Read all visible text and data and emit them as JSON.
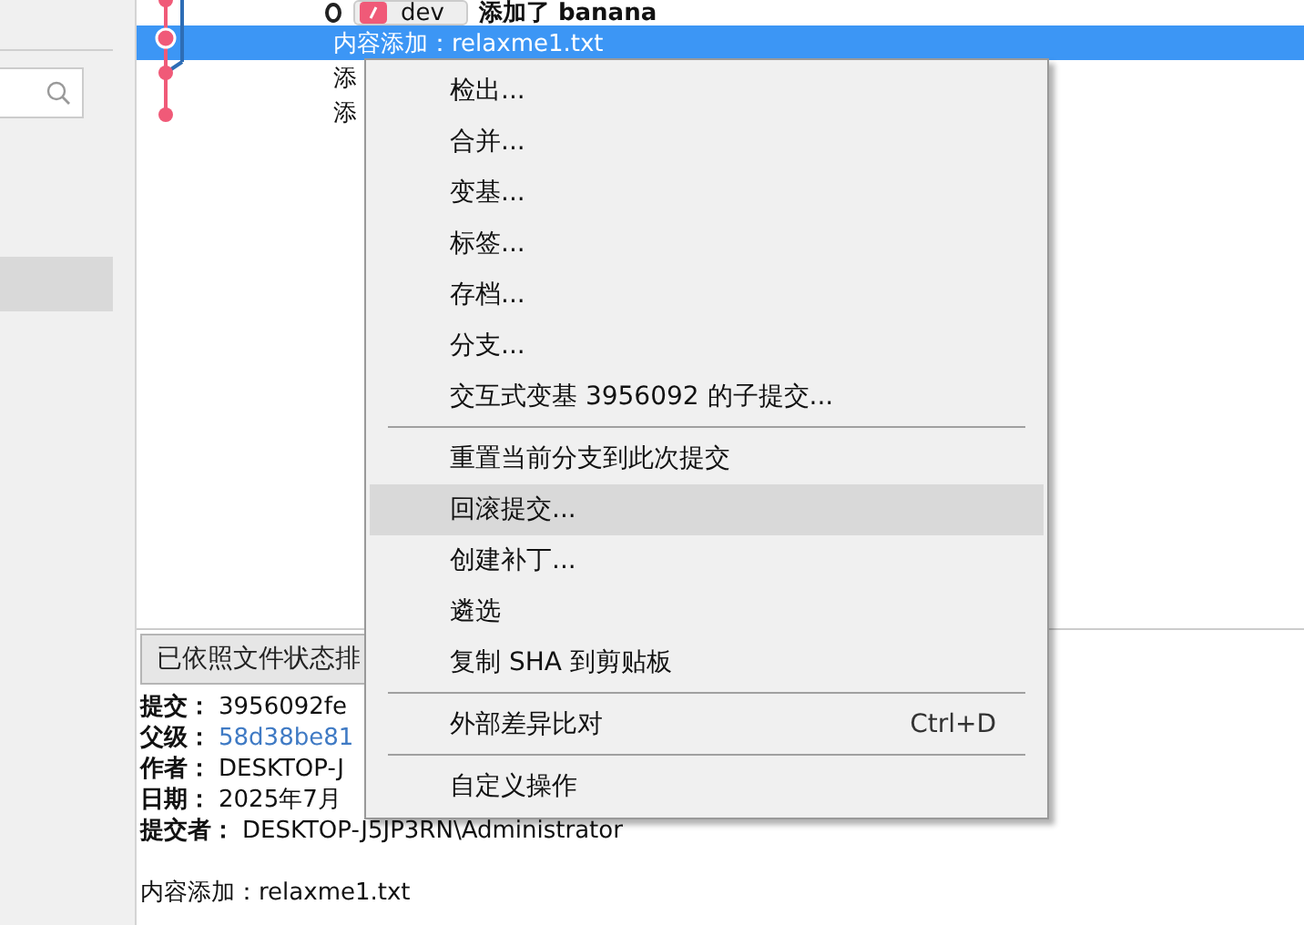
{
  "sidebar": {
    "items": [
      {
        "selected": true
      }
    ]
  },
  "commits": [
    {
      "tag": "dev",
      "message": "添加了 banana",
      "selected": false
    },
    {
      "message": "内容添加：relaxme1.txt",
      "selected": true
    },
    {
      "message": "添",
      "selected": false
    },
    {
      "message": "添",
      "selected": false
    }
  ],
  "file_sort_button": "已依照文件状态排",
  "details": [
    {
      "label": "提交：",
      "value": "3956092fe",
      "kind": "text"
    },
    {
      "label": "父级：",
      "value": "58d38be81",
      "kind": "link"
    },
    {
      "label": "作者：",
      "value": "DESKTOP-J",
      "kind": "text"
    },
    {
      "label": "日期：",
      "value": "2025年7月",
      "kind": "text"
    },
    {
      "label": "提交者：",
      "value": "DESKTOP-J5JP3RN\\Administrator",
      "kind": "text"
    }
  ],
  "commit_message": "内容添加：relaxme1.txt",
  "context_menu": [
    {
      "kind": "item",
      "label": "检出...",
      "highlighted": false
    },
    {
      "kind": "item",
      "label": "合并...",
      "highlighted": false
    },
    {
      "kind": "item",
      "label": "变基...",
      "highlighted": false
    },
    {
      "kind": "item",
      "label": "标签...",
      "highlighted": false
    },
    {
      "kind": "item",
      "label": "存档...",
      "highlighted": false
    },
    {
      "kind": "item",
      "label": "分支...",
      "highlighted": false
    },
    {
      "kind": "item",
      "label": "交互式变基 3956092 的子提交...",
      "highlighted": false
    },
    {
      "kind": "separator"
    },
    {
      "kind": "item",
      "label": "重置当前分支到此次提交",
      "highlighted": false
    },
    {
      "kind": "item",
      "label": "回滚提交...",
      "highlighted": true
    },
    {
      "kind": "item",
      "label": "创建补丁...",
      "highlighted": false
    },
    {
      "kind": "item",
      "label": "遴选",
      "highlighted": false
    },
    {
      "kind": "item",
      "label": "复制 SHA 到剪贴板",
      "highlighted": false
    },
    {
      "kind": "separator"
    },
    {
      "kind": "item",
      "label": "外部差异比对",
      "shortcut": "Ctrl+D",
      "highlighted": false
    },
    {
      "kind": "separator"
    },
    {
      "kind": "item",
      "label": "自定义操作",
      "highlighted": false
    }
  ]
}
